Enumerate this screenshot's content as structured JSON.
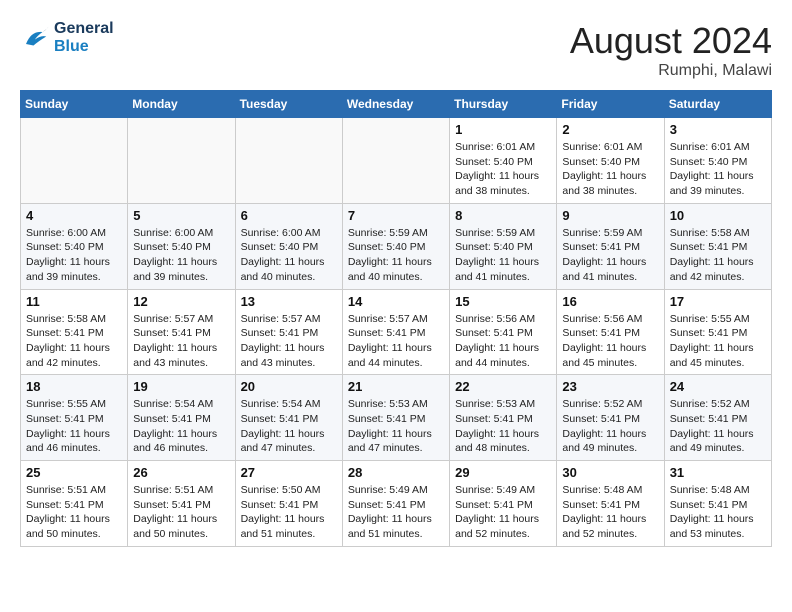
{
  "header": {
    "logo_line1": "General",
    "logo_line2": "Blue",
    "month_year": "August 2024",
    "location": "Rumphi, Malawi"
  },
  "calendar": {
    "days_of_week": [
      "Sunday",
      "Monday",
      "Tuesday",
      "Wednesday",
      "Thursday",
      "Friday",
      "Saturday"
    ],
    "weeks": [
      [
        {
          "day": "",
          "info": ""
        },
        {
          "day": "",
          "info": ""
        },
        {
          "day": "",
          "info": ""
        },
        {
          "day": "",
          "info": ""
        },
        {
          "day": "1",
          "info": "Sunrise: 6:01 AM\nSunset: 5:40 PM\nDaylight: 11 hours\nand 38 minutes."
        },
        {
          "day": "2",
          "info": "Sunrise: 6:01 AM\nSunset: 5:40 PM\nDaylight: 11 hours\nand 38 minutes."
        },
        {
          "day": "3",
          "info": "Sunrise: 6:01 AM\nSunset: 5:40 PM\nDaylight: 11 hours\nand 39 minutes."
        }
      ],
      [
        {
          "day": "4",
          "info": "Sunrise: 6:00 AM\nSunset: 5:40 PM\nDaylight: 11 hours\nand 39 minutes."
        },
        {
          "day": "5",
          "info": "Sunrise: 6:00 AM\nSunset: 5:40 PM\nDaylight: 11 hours\nand 39 minutes."
        },
        {
          "day": "6",
          "info": "Sunrise: 6:00 AM\nSunset: 5:40 PM\nDaylight: 11 hours\nand 40 minutes."
        },
        {
          "day": "7",
          "info": "Sunrise: 5:59 AM\nSunset: 5:40 PM\nDaylight: 11 hours\nand 40 minutes."
        },
        {
          "day": "8",
          "info": "Sunrise: 5:59 AM\nSunset: 5:40 PM\nDaylight: 11 hours\nand 41 minutes."
        },
        {
          "day": "9",
          "info": "Sunrise: 5:59 AM\nSunset: 5:41 PM\nDaylight: 11 hours\nand 41 minutes."
        },
        {
          "day": "10",
          "info": "Sunrise: 5:58 AM\nSunset: 5:41 PM\nDaylight: 11 hours\nand 42 minutes."
        }
      ],
      [
        {
          "day": "11",
          "info": "Sunrise: 5:58 AM\nSunset: 5:41 PM\nDaylight: 11 hours\nand 42 minutes."
        },
        {
          "day": "12",
          "info": "Sunrise: 5:57 AM\nSunset: 5:41 PM\nDaylight: 11 hours\nand 43 minutes."
        },
        {
          "day": "13",
          "info": "Sunrise: 5:57 AM\nSunset: 5:41 PM\nDaylight: 11 hours\nand 43 minutes."
        },
        {
          "day": "14",
          "info": "Sunrise: 5:57 AM\nSunset: 5:41 PM\nDaylight: 11 hours\nand 44 minutes."
        },
        {
          "day": "15",
          "info": "Sunrise: 5:56 AM\nSunset: 5:41 PM\nDaylight: 11 hours\nand 44 minutes."
        },
        {
          "day": "16",
          "info": "Sunrise: 5:56 AM\nSunset: 5:41 PM\nDaylight: 11 hours\nand 45 minutes."
        },
        {
          "day": "17",
          "info": "Sunrise: 5:55 AM\nSunset: 5:41 PM\nDaylight: 11 hours\nand 45 minutes."
        }
      ],
      [
        {
          "day": "18",
          "info": "Sunrise: 5:55 AM\nSunset: 5:41 PM\nDaylight: 11 hours\nand 46 minutes."
        },
        {
          "day": "19",
          "info": "Sunrise: 5:54 AM\nSunset: 5:41 PM\nDaylight: 11 hours\nand 46 minutes."
        },
        {
          "day": "20",
          "info": "Sunrise: 5:54 AM\nSunset: 5:41 PM\nDaylight: 11 hours\nand 47 minutes."
        },
        {
          "day": "21",
          "info": "Sunrise: 5:53 AM\nSunset: 5:41 PM\nDaylight: 11 hours\nand 47 minutes."
        },
        {
          "day": "22",
          "info": "Sunrise: 5:53 AM\nSunset: 5:41 PM\nDaylight: 11 hours\nand 48 minutes."
        },
        {
          "day": "23",
          "info": "Sunrise: 5:52 AM\nSunset: 5:41 PM\nDaylight: 11 hours\nand 49 minutes."
        },
        {
          "day": "24",
          "info": "Sunrise: 5:52 AM\nSunset: 5:41 PM\nDaylight: 11 hours\nand 49 minutes."
        }
      ],
      [
        {
          "day": "25",
          "info": "Sunrise: 5:51 AM\nSunset: 5:41 PM\nDaylight: 11 hours\nand 50 minutes."
        },
        {
          "day": "26",
          "info": "Sunrise: 5:51 AM\nSunset: 5:41 PM\nDaylight: 11 hours\nand 50 minutes."
        },
        {
          "day": "27",
          "info": "Sunrise: 5:50 AM\nSunset: 5:41 PM\nDaylight: 11 hours\nand 51 minutes."
        },
        {
          "day": "28",
          "info": "Sunrise: 5:49 AM\nSunset: 5:41 PM\nDaylight: 11 hours\nand 51 minutes."
        },
        {
          "day": "29",
          "info": "Sunrise: 5:49 AM\nSunset: 5:41 PM\nDaylight: 11 hours\nand 52 minutes."
        },
        {
          "day": "30",
          "info": "Sunrise: 5:48 AM\nSunset: 5:41 PM\nDaylight: 11 hours\nand 52 minutes."
        },
        {
          "day": "31",
          "info": "Sunrise: 5:48 AM\nSunset: 5:41 PM\nDaylight: 11 hours\nand 53 minutes."
        }
      ]
    ]
  }
}
